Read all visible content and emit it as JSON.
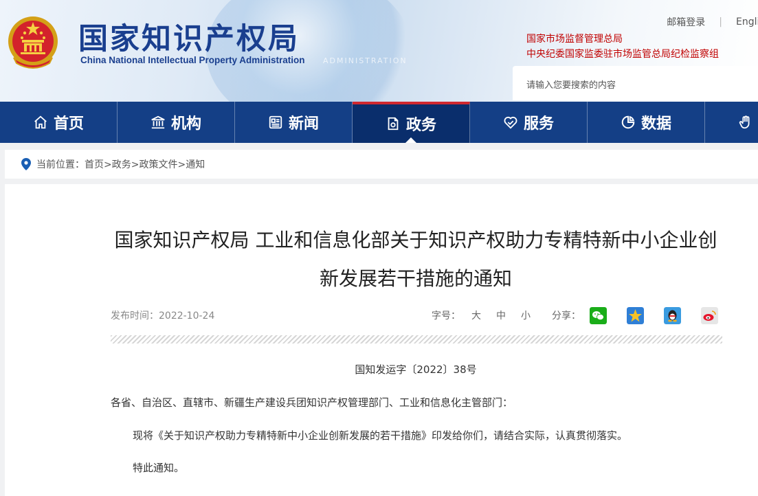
{
  "header": {
    "site_title": "国家知识产权局",
    "site_subtitle": "China National Intellectual Property Administration",
    "bg_watermark": "ADMINISTRATION",
    "mail_login": "邮箱登录",
    "english": "English",
    "org_links": [
      "国家市场监督管理总局",
      "中央纪委国家监委驻市场监管总局纪检监察组"
    ],
    "search_placeholder": "请输入您要搜索的内容",
    "brand_color": "#1a3f8f",
    "accent_color": "#c00000"
  },
  "nav": {
    "items": [
      {
        "label": "首页",
        "icon": "home-icon"
      },
      {
        "label": "机构",
        "icon": "institution-icon"
      },
      {
        "label": "新闻",
        "icon": "news-icon"
      },
      {
        "label": "政务",
        "icon": "government-affairs-icon",
        "active": true
      },
      {
        "label": "服务",
        "icon": "service-heart-icon"
      },
      {
        "label": "数据",
        "icon": "pie-chart-icon"
      },
      {
        "label": "",
        "icon": "hand-icon"
      }
    ],
    "bg_color": "#143f86"
  },
  "breadcrumb": {
    "prefix": "当前位置：",
    "path": "首页>政务>政策文件>通知"
  },
  "article": {
    "title_line1": "国家知识产权局 工业和信息化部关于知识产权助力专精特新中小企业创",
    "title_line2": "新发展若干措施的通知",
    "publish_label": "发布时间：",
    "publish_date": "2022-10-24",
    "fontsize_label": "字号：",
    "fontsize_large": "大",
    "fontsize_medium": "中",
    "fontsize_small": "小",
    "share_label": "分享：",
    "share_icons": [
      "wechat-icon",
      "qzone-star-icon",
      "qq-penguin-icon",
      "weibo-icon"
    ],
    "doc_number": "国知发运字〔2022〕38号",
    "salutation": "各省、自治区、直辖市、新疆生产建设兵团知识产权管理部门、工业和信息化主管部门：",
    "body_1": "现将《关于知识产权助力专精特新中小企业创新发展的若干措施》印发给你们，请结合实际，认真贯彻落实。",
    "body_2": "特此通知。"
  }
}
